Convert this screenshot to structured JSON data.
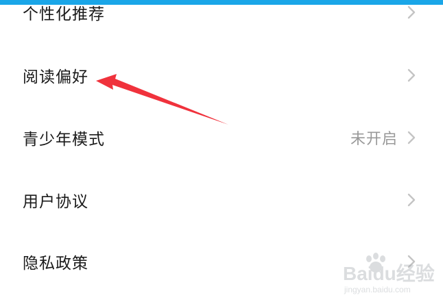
{
  "settings": {
    "items": [
      {
        "label": "个性化推荐",
        "value": ""
      },
      {
        "label": "阅读偏好",
        "value": ""
      },
      {
        "label": "青少年模式",
        "value": "未开启"
      },
      {
        "label": "用户协议",
        "value": ""
      },
      {
        "label": "隐私政策",
        "value": ""
      }
    ]
  },
  "watermark": {
    "text": "Baidu经验",
    "url_text": "jingyan.baidu.com"
  },
  "colors": {
    "top_bar": "#1aa6e8",
    "annotation_arrow": "#f0323c",
    "label_text": "#1a1a1a",
    "value_text": "#999999",
    "chevron": "#c4c4c4"
  },
  "icons": {
    "chevron": "chevron-right-icon",
    "annotation": "red-arrow-annotation"
  }
}
